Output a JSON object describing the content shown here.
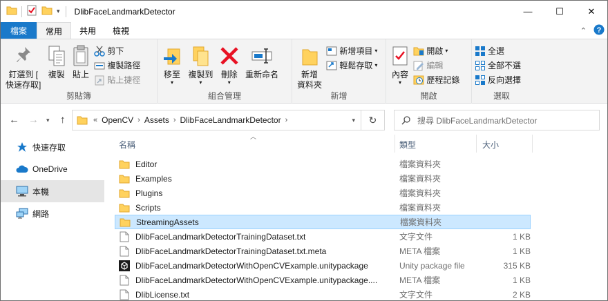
{
  "window": {
    "title": "DlibFaceLandmarkDetector"
  },
  "window_controls": {
    "minimize": "—",
    "maximize": "☐",
    "close": "✕"
  },
  "ribbon_tabs": [
    {
      "label": "檔案"
    },
    {
      "label": "常用"
    },
    {
      "label": "共用"
    },
    {
      "label": "檢視"
    }
  ],
  "ribbon": {
    "clipboard": {
      "pin_label": "釘選到 [\n快速存取]",
      "copy_label": "複製",
      "paste_label": "貼上",
      "cut_label": "剪下",
      "copy_path_label": "複製路徑",
      "paste_shortcut_label": "貼上捷徑",
      "group_label": "剪貼簿"
    },
    "organize": {
      "move_label": "移至",
      "copy_to_label": "複製到",
      "delete_label": "刪除",
      "rename_label": "重新命名",
      "group_label": "組合管理"
    },
    "new": {
      "new_folder_label": "新增\n資料夾",
      "new_item_label": "新增項目",
      "easy_access_label": "輕鬆存取",
      "group_label": "新增"
    },
    "open": {
      "properties_label": "內容",
      "open_label": "開啟",
      "edit_label": "編輯",
      "history_label": "歷程記錄",
      "group_label": "開啟"
    },
    "select": {
      "select_all_label": "全選",
      "select_none_label": "全部不選",
      "invert_label": "反向選擇",
      "group_label": "選取"
    }
  },
  "address": {
    "overflow": "«",
    "crumbs": [
      {
        "label": "OpenCV"
      },
      {
        "label": "Assets"
      },
      {
        "label": "DlibFaceLandmarkDetector"
      }
    ]
  },
  "search": {
    "placeholder": "搜尋 DlibFaceLandmarkDetector"
  },
  "nav_pane": [
    {
      "label": "快速存取",
      "icon": "star-icon"
    },
    {
      "label": "OneDrive",
      "icon": "cloud-icon"
    },
    {
      "label": "本機",
      "icon": "computer-icon",
      "selected": true
    },
    {
      "label": "網路",
      "icon": "network-icon"
    }
  ],
  "columns": {
    "name": "名稱",
    "type": "類型",
    "size": "大小"
  },
  "files": [
    {
      "name": "Editor",
      "type": "檔案資料夾",
      "size": "",
      "icon": "folder-icon"
    },
    {
      "name": "Examples",
      "type": "檔案資料夾",
      "size": "",
      "icon": "folder-icon"
    },
    {
      "name": "Plugins",
      "type": "檔案資料夾",
      "size": "",
      "icon": "folder-icon"
    },
    {
      "name": "Scripts",
      "type": "檔案資料夾",
      "size": "",
      "icon": "folder-icon"
    },
    {
      "name": "StreamingAssets",
      "type": "檔案資料夾",
      "size": "",
      "icon": "folder-icon",
      "selected": true
    },
    {
      "name": "DlibFaceLandmarkDetectorTrainingDataset.txt",
      "type": "文字文件",
      "size": "1 KB",
      "icon": "document-icon"
    },
    {
      "name": "DlibFaceLandmarkDetectorTrainingDataset.txt.meta",
      "type": "META 檔案",
      "size": "1 KB",
      "icon": "document-icon"
    },
    {
      "name": "DlibFaceLandmarkDetectorWithOpenCVExample.unitypackage",
      "type": "Unity package file",
      "size": "315 KB",
      "icon": "unity-package-icon"
    },
    {
      "name": "DlibFaceLandmarkDetectorWithOpenCVExample.unitypackage....",
      "type": "META 檔案",
      "size": "1 KB",
      "icon": "document-icon"
    },
    {
      "name": "DlibLicense.txt",
      "type": "文字文件",
      "size": "2 KB",
      "icon": "document-icon"
    }
  ],
  "colors": {
    "accent": "#1979ca",
    "folder": "#ffd25e",
    "selection": "#cce8ff",
    "delete": "#e81123"
  }
}
